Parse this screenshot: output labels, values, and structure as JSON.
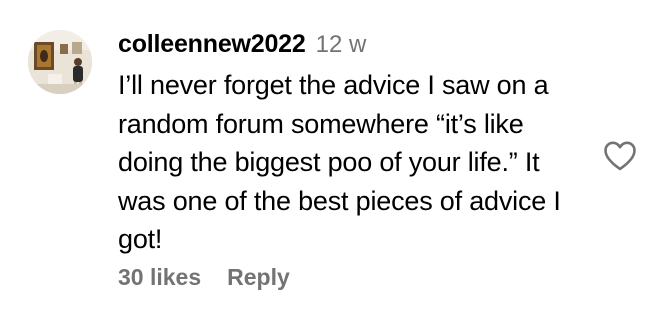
{
  "comment": {
    "username": "colleennew2022",
    "timestamp": "12 w",
    "text": "I’ll never forget the advice I saw on a random forum somewhere “it’s like doing the biggest poo of your life.” It was one of the best pieces of advice I got!",
    "likes_label": "30 likes",
    "reply_label": "Reply",
    "like_icon": "heart-outline-icon",
    "colors": {
      "primary_text": "#000000",
      "secondary_text": "#737373",
      "background": "#ffffff"
    }
  }
}
